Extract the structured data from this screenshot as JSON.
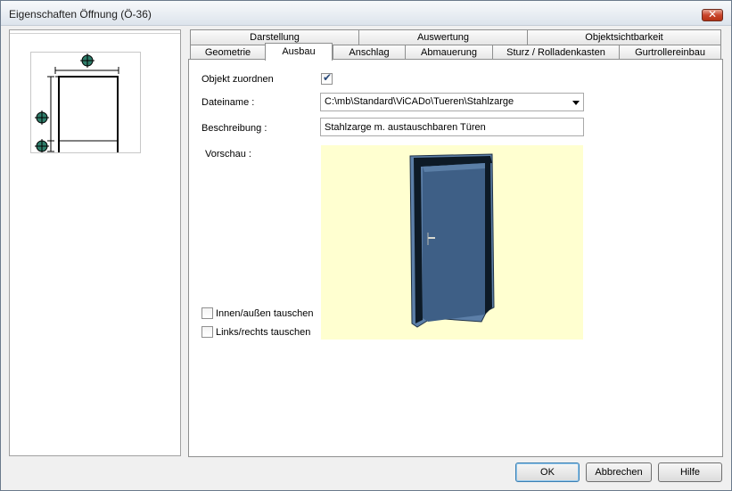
{
  "window": {
    "title": "Eigenschaften Öffnung (Ö-36)",
    "close_symbol": "✕"
  },
  "tabs_row1": [
    {
      "label": "Darstellung"
    },
    {
      "label": "Auswertung"
    },
    {
      "label": "Objektsichtbarkeit"
    }
  ],
  "tabs_row2": [
    {
      "label": "Geometrie"
    },
    {
      "label": "Ausbau"
    },
    {
      "label": "Anschlag"
    },
    {
      "label": "Abmauerung"
    },
    {
      "label": "Sturz / Rolladenkasten"
    },
    {
      "label": "Gurtrollereinbau"
    }
  ],
  "active_tab": "Ausbau",
  "form": {
    "objekt_zuordnen_label": "Objekt zuordnen",
    "objekt_zuordnen_checked": true,
    "dateiname_label": "Dateiname :",
    "dateiname_value": "C:\\mb\\Standard\\ViCADo\\Tueren\\Stahlzarge",
    "beschreibung_label": "Beschreibung :",
    "beschreibung_value": "Stahlzarge m. austauschbaren Türen",
    "vorschau_label": "Vorschau :",
    "innen_aussen_label": "Innen/außen tauschen",
    "innen_aussen_checked": false,
    "links_rechts_label": "Links/rechts tauschen",
    "links_rechts_checked": false
  },
  "buttons": {
    "ok": "OK",
    "abbrechen": "Abbrechen",
    "hilfe": "Hilfe"
  },
  "colors": {
    "preview_bg": "#ffffd0",
    "door_leaf": "#3e5f86",
    "door_frame": "#0d1a26",
    "marker": "#2e7d6a"
  }
}
